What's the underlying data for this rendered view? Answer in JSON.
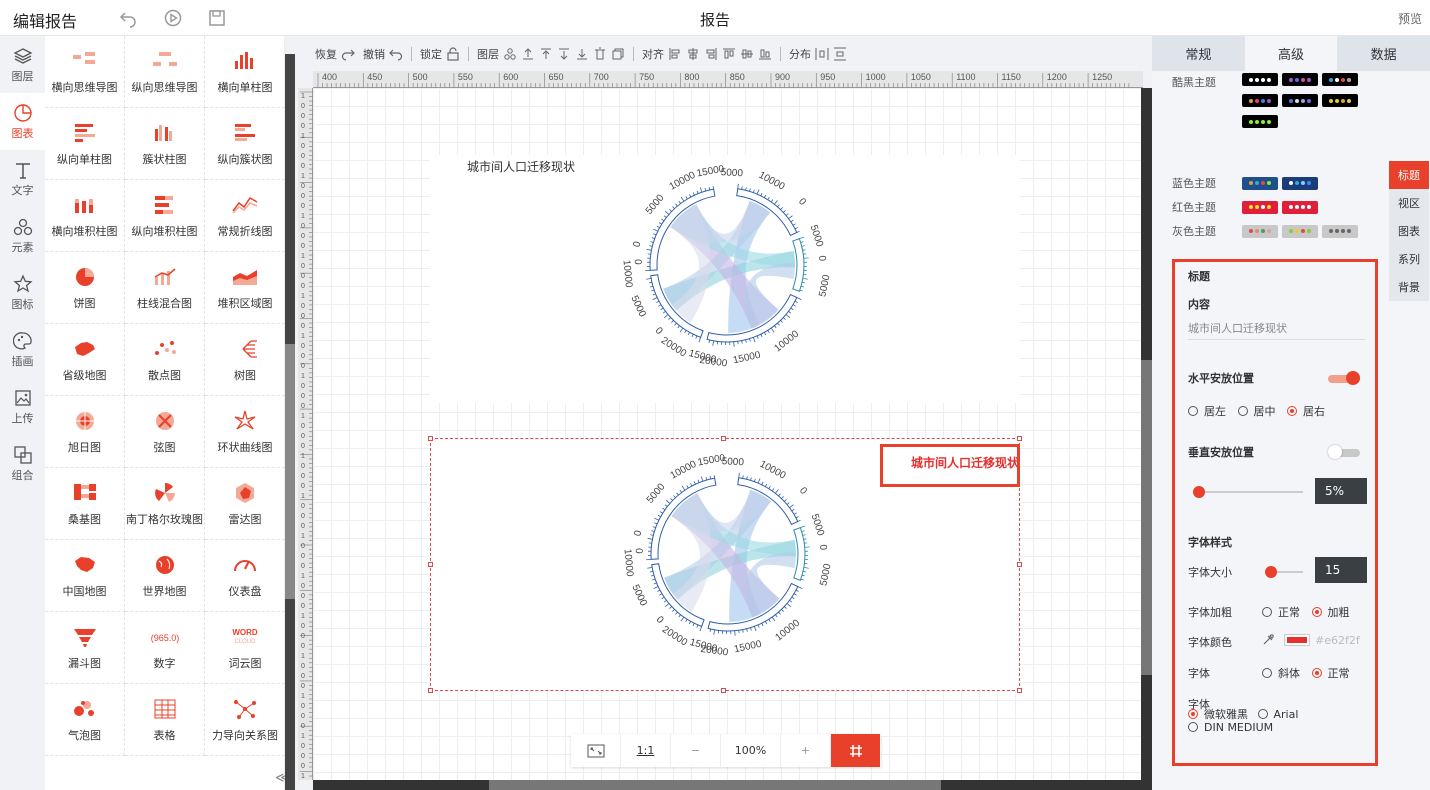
{
  "header": {
    "title": "编辑报告",
    "center_title": "报告",
    "preview_label": "预览"
  },
  "left_nav": [
    {
      "label": "图层",
      "icon": "layers-icon"
    },
    {
      "label": "图表",
      "icon": "chart-pie-icon",
      "active": true
    },
    {
      "label": "文字",
      "icon": "text-icon"
    },
    {
      "label": "元素",
      "icon": "elements-icon"
    },
    {
      "label": "图标",
      "icon": "star-icon"
    },
    {
      "label": "插画",
      "icon": "palette-icon"
    },
    {
      "label": "上传",
      "icon": "upload-icon"
    },
    {
      "label": "组合",
      "icon": "group-icon"
    }
  ],
  "gallery": [
    {
      "label": "横向思维导图"
    },
    {
      "label": "纵向思维导图"
    },
    {
      "label": "横向单柱图"
    },
    {
      "label": "纵向单柱图"
    },
    {
      "label": "簇状柱图"
    },
    {
      "label": "纵向簇状图"
    },
    {
      "label": "横向堆积柱图"
    },
    {
      "label": "纵向堆积柱图"
    },
    {
      "label": "常规折线图"
    },
    {
      "label": "饼图"
    },
    {
      "label": "柱线混合图"
    },
    {
      "label": "堆积区域图"
    },
    {
      "label": "省级地图"
    },
    {
      "label": "散点图"
    },
    {
      "label": "树图"
    },
    {
      "label": "旭日图"
    },
    {
      "label": "弦图"
    },
    {
      "label": "环状曲线图"
    },
    {
      "label": "桑基图"
    },
    {
      "label": "南丁格尔玫瑰图"
    },
    {
      "label": "雷达图"
    },
    {
      "label": "中国地图"
    },
    {
      "label": "世界地图"
    },
    {
      "label": "仪表盘"
    },
    {
      "label": "漏斗图"
    },
    {
      "label": "数字"
    },
    {
      "label": "词云图"
    },
    {
      "label": "气泡图"
    },
    {
      "label": "表格"
    },
    {
      "label": "力导向关系图"
    }
  ],
  "gallery_icon_texts": {
    "number": "965.0",
    "word": "WORD",
    "cloud": "CLOUD"
  },
  "toolbar": {
    "redo": "恢复",
    "undo": "撤销",
    "lock": "锁定",
    "layer": "图层",
    "align": "对齐",
    "distribute": "分布"
  },
  "ruler_labels": [
    "400",
    "450",
    "500",
    "550",
    "600",
    "650",
    "700",
    "750",
    "800",
    "850",
    "900",
    "950",
    "1000",
    "1050",
    "1100",
    "1150",
    "1200",
    "1250"
  ],
  "widgets": [
    {
      "title": "城市间人口迁移现状"
    },
    {
      "title": "城市间人口迁移现状",
      "title_color": "#e62f2f"
    }
  ],
  "chord_ticks": [
    "15000",
    "10000",
    "5000",
    "0",
    "5000",
    "10000",
    "0",
    "5000",
    "0",
    "5000",
    "10000",
    "15000",
    "20000",
    "0",
    "5000",
    "10000",
    "0",
    "5000",
    "10000"
  ],
  "zoom": {
    "fit_label": "",
    "actual_label": "1:1",
    "minus": "−",
    "value": "100%",
    "plus": "+"
  },
  "right_panel": {
    "tabs": [
      {
        "label": "常规"
      },
      {
        "label": "高级",
        "active": true
      },
      {
        "label": "数据"
      }
    ],
    "themes": [
      {
        "label": "酷黑主题"
      },
      {
        "label": "蓝色主题"
      },
      {
        "label": "红色主题"
      },
      {
        "label": "灰色主题"
      }
    ],
    "subtabs": [
      {
        "label": "标题",
        "active": true
      },
      {
        "label": "视区"
      },
      {
        "label": "图表"
      },
      {
        "label": "系列"
      },
      {
        "label": "背景"
      }
    ],
    "props": {
      "section": "标题",
      "content_label": "内容",
      "content_value": "城市间人口迁移现状",
      "h_pos_label": "水平安放位置",
      "h_pos_enabled": true,
      "h_left": "居左",
      "h_center": "居中",
      "h_right": "居右",
      "h_selected": "居右",
      "v_pos_label": "垂直安放位置",
      "v_pos_enabled": false,
      "v_value": "5%",
      "font_style_label": "字体样式",
      "font_size_label": "字体大小",
      "font_size_value": "15",
      "font_weight_label": "字体加粗",
      "weight_normal": "正常",
      "weight_bold": "加粗",
      "weight_selected": "加粗",
      "font_color_label": "字体颜色",
      "font_color": "#e62f2f",
      "font_italic_label": "字体",
      "italic_label": "斜体",
      "italic_normal": "正常",
      "italic_selected": "正常",
      "font_family_label": "字体",
      "family_options": [
        "微软雅黑",
        "Arial",
        "DIN MEDIUM"
      ],
      "family_selected": "微软雅黑"
    }
  },
  "accent": "#e8402a"
}
